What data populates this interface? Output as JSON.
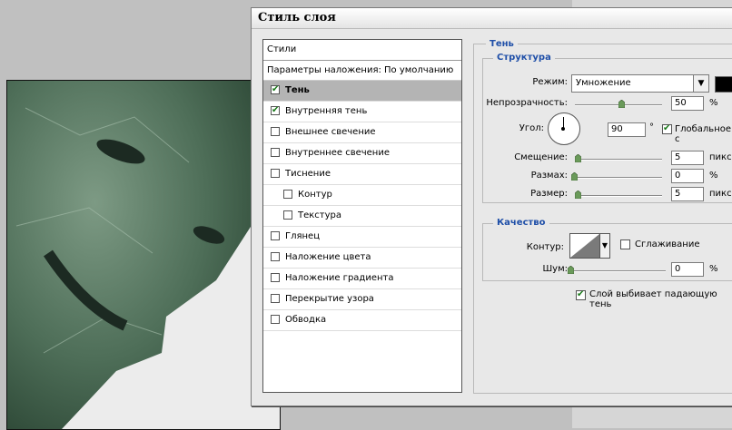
{
  "dialog": {
    "title": "Стиль слоя",
    "styles_header": "Стили",
    "blend_options": "Параметры наложения: По умолчанию",
    "styles": [
      {
        "label": "Тень",
        "checked": true,
        "selected": true,
        "sub": false
      },
      {
        "label": "Внутренняя тень",
        "checked": true,
        "selected": false,
        "sub": false
      },
      {
        "label": "Внешнее свечение",
        "checked": false,
        "selected": false,
        "sub": false
      },
      {
        "label": "Внутреннее свечение",
        "checked": false,
        "selected": false,
        "sub": false
      },
      {
        "label": "Тиснение",
        "checked": false,
        "selected": false,
        "sub": false
      },
      {
        "label": "Контур",
        "checked": false,
        "selected": false,
        "sub": true
      },
      {
        "label": "Текстура",
        "checked": false,
        "selected": false,
        "sub": true
      },
      {
        "label": "Глянец",
        "checked": false,
        "selected": false,
        "sub": false
      },
      {
        "label": "Наложение цвета",
        "checked": false,
        "selected": false,
        "sub": false
      },
      {
        "label": "Наложение градиента",
        "checked": false,
        "selected": false,
        "sub": false
      },
      {
        "label": "Перекрытие узора",
        "checked": false,
        "selected": false,
        "sub": false
      },
      {
        "label": "Обводка",
        "checked": false,
        "selected": false,
        "sub": false
      }
    ]
  },
  "shadow": {
    "section_title": "Тень",
    "structure": {
      "title": "Структура",
      "mode_label": "Режим:",
      "mode_value": "Умножение",
      "mode_color": "#000000",
      "opacity_label": "Непрозрачность:",
      "opacity_value": "50",
      "opacity_unit": "%",
      "opacity_fraction": 0.5,
      "angle_label": "Угол:",
      "angle_value": "90",
      "angle_unit": "°",
      "global_light_label": "Глобальное с",
      "global_light_checked": true,
      "distance_label": "Смещение:",
      "distance_value": "5",
      "distance_unit": "пикс.",
      "spread_label": "Размах:",
      "spread_value": "0",
      "spread_unit": "%",
      "size_label": "Размер:",
      "size_value": "5",
      "size_unit": "пикс."
    },
    "quality": {
      "title": "Качество",
      "contour_label": "Контур:",
      "antialias_label": "Сглаживание",
      "antialias_checked": false,
      "noise_label": "Шум:",
      "noise_value": "0",
      "noise_unit": "%",
      "knockout_label": "Слой выбивает падающую тень",
      "knockout_checked": true
    }
  }
}
